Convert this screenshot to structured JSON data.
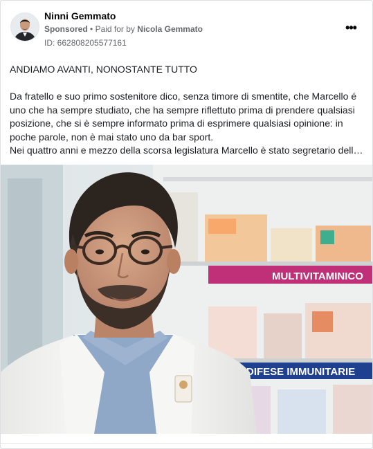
{
  "ad": {
    "page_name": "Ninni Gemmato",
    "sponsored_label": "Sponsored",
    "separator": "•",
    "paid_for_prefix": "Paid for by",
    "paid_for_by": "Nicola Gemmato",
    "ad_id": "ID: 662808205577161",
    "more_icon": "more-options-icon"
  },
  "post": {
    "headline": "ANDIAMO AVANTI, NONOSTANTE TUTTO",
    "paragraph_lines": [
      "Da fratello e suo primo sostenitore dico, senza timore di smentite, che Marcello é",
      "uno che ha sempre studiato, che ha sempre riflettuto prima di prendere qualsiasi",
      "posizione, che si è sempre informato prima di esprimere qualsiasi opinione: in",
      "poche parole, non è mai stato uno da bar sport.",
      "Nei quattro anni e mezzo della scorsa legislatura Marcello è stato segretario dell…"
    ]
  },
  "image": {
    "shelf_label_1": "MULTIVITAMINICO",
    "shelf_label_2": "DIFESE IMMUNITARIE",
    "colors": {
      "shelf_banner": "#c03078",
      "shelf_banner_2": "#1f3f8f",
      "coat": "#f4f4f2",
      "shirt": "#8fa8c8"
    }
  }
}
